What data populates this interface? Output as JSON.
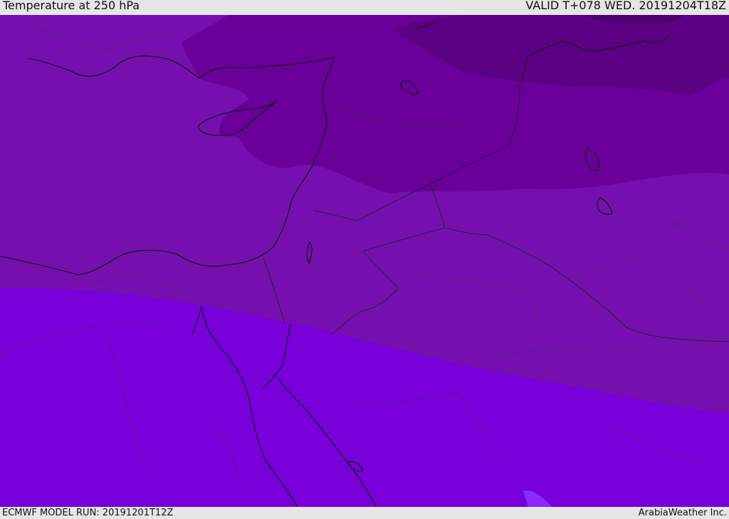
{
  "header": {
    "title": "Temperature at 250 hPa",
    "valid_time": "VALID T+078 WED. 20191204T18Z"
  },
  "footer": {
    "model_run": "ECMWF MODEL RUN: 20191201T12Z",
    "credit": "ArabiaWeather Inc."
  },
  "colors": {
    "coldest": "#4f0070",
    "very_cold": "#5c0084",
    "cold": "#69009a",
    "cool": "#7510ae",
    "mild": "#7800d8",
    "warm_patch": "#8a2cff",
    "coast_lines": "#111111",
    "border_lines": "#222222"
  }
}
